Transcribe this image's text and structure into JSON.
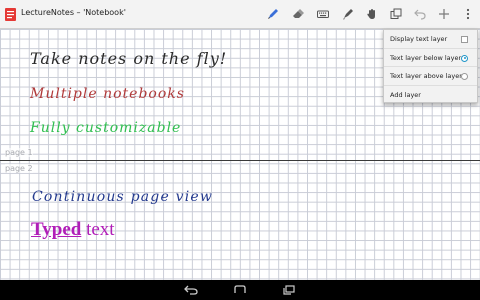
{
  "app": {
    "title": "LectureNotes – 'Notebook'",
    "accent_color": "#e53935"
  },
  "toolbar": {
    "icons": [
      "pen-icon",
      "eraser-icon",
      "keyboard-icon",
      "marker-icon",
      "hand-icon",
      "layers-icon",
      "undo-icon",
      "add-icon",
      "overflow-menu-icon"
    ]
  },
  "pages": {
    "page1_label": "page 1",
    "page2_label": "page 2"
  },
  "handwriting": {
    "line1": "Take notes on the fly!",
    "line2": "Multiple notebooks",
    "line3": "Fully customizable",
    "line4": "Continuous page view"
  },
  "typed_text": {
    "bold_word": "Typed",
    "rest": " text",
    "color": "#b11eb8"
  },
  "layer_menu": {
    "items": [
      {
        "label": "Display text layer",
        "control": "checkbox",
        "checked": false
      },
      {
        "label": "Text layer below layer 1",
        "control": "radio",
        "checked": true
      },
      {
        "label": "Text layer above layer 1",
        "control": "radio",
        "checked": false
      },
      {
        "label": "Add layer",
        "control": "none"
      }
    ]
  },
  "navbar": {
    "icons": [
      "back-icon",
      "home-icon",
      "recents-icon"
    ]
  }
}
